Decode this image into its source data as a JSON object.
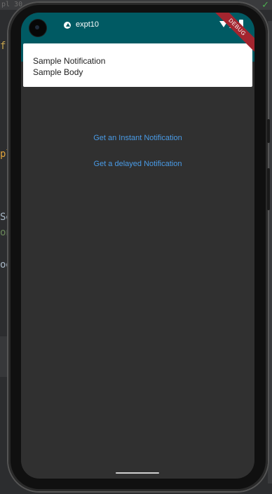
{
  "editor": {
    "top_text": "pl 30",
    "fragments": [
      "f",
      "pl",
      "Se",
      "on",
      "og"
    ]
  },
  "status_bar": {
    "app_name": "expt10",
    "debug_label": "DEBUG",
    "background": "#005a63"
  },
  "notification": {
    "title": "Sample Notification",
    "body": "Sample Body"
  },
  "actions": {
    "instant_label": "Get an Instant Notification",
    "delayed_label": "Get a delayed Notification",
    "color": "#4a9be6"
  },
  "icons": [
    "app-indicator-icon",
    "wifi-icon",
    "signal-icon",
    "battery-icon",
    "check-icon"
  ]
}
